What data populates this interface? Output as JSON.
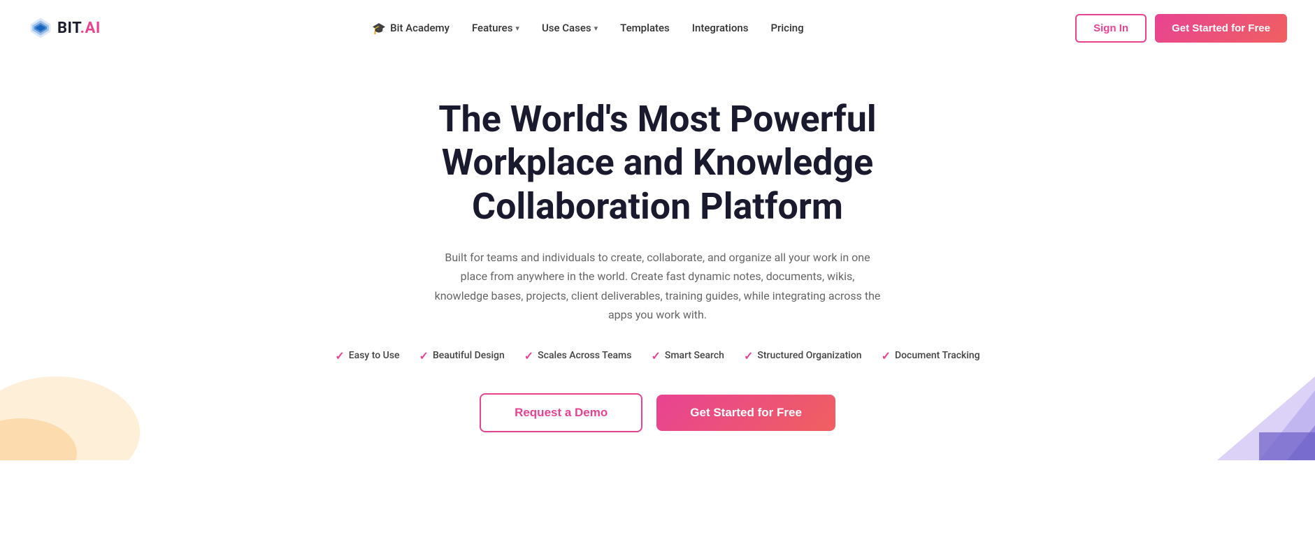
{
  "logo": {
    "text_bit": "BIT",
    "text_ai": ".AI"
  },
  "navbar": {
    "academy_label": "Bit Academy",
    "features_label": "Features",
    "use_cases_label": "Use Cases",
    "templates_label": "Templates",
    "integrations_label": "Integrations",
    "pricing_label": "Pricing",
    "signin_label": "Sign In",
    "get_started_label": "Get Started for Free"
  },
  "hero": {
    "title_line1": "The World's Most Powerful",
    "title_line2": "Workplace and Knowledge Collaboration Platform",
    "subtitle": "Built for teams and individuals to create, collaborate, and organize all your work in one place from anywhere in the world. Create fast dynamic notes, documents, wikis, knowledge bases, projects, client deliverables, training guides, while integrating across the apps you work with.",
    "features": [
      {
        "id": "easy",
        "label": "Easy to Use"
      },
      {
        "id": "design",
        "label": "Beautiful Design"
      },
      {
        "id": "scales",
        "label": "Scales Across Teams"
      },
      {
        "id": "search",
        "label": "Smart Search"
      },
      {
        "id": "org",
        "label": "Structured Organization"
      },
      {
        "id": "tracking",
        "label": "Document Tracking"
      }
    ],
    "btn_demo_label": "Request a Demo",
    "btn_get_started_label": "Get Started for Free"
  },
  "colors": {
    "accent": "#e84393",
    "accent_gradient_end": "#f06060"
  }
}
